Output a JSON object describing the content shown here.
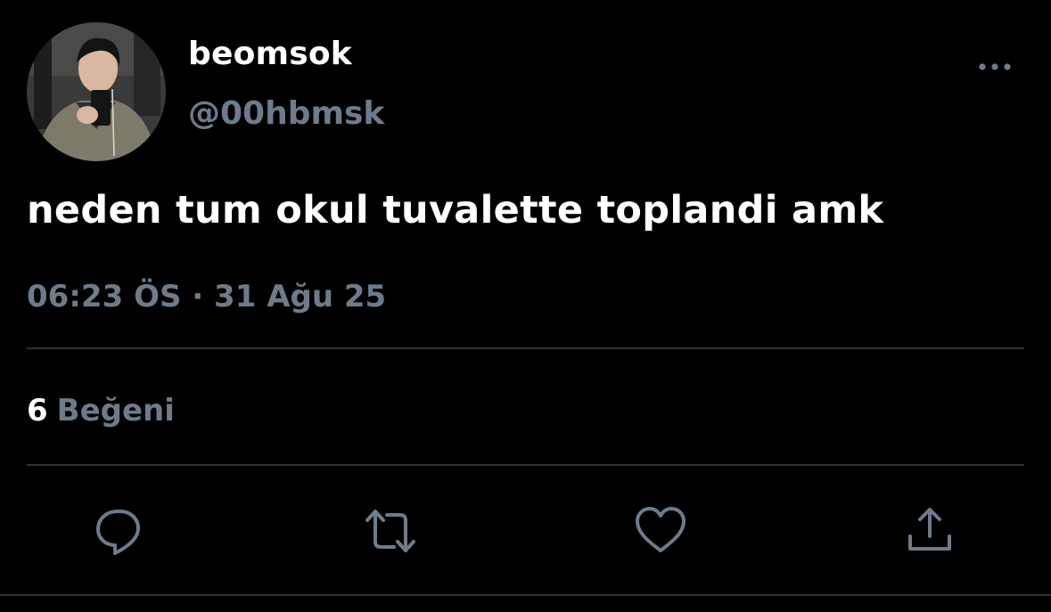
{
  "colors": {
    "background": "#000000",
    "primary_text": "#ffffff",
    "secondary_text": "#6e7b8a",
    "divider": "#2f3336",
    "icon": "#6e7b8a"
  },
  "user": {
    "display_name": "beomsok",
    "handle": "@00hbmsk",
    "avatar_icon": "profile-photo"
  },
  "tweet": {
    "text": "neden tum okul tuvalette toplandi amk",
    "timestamp": "06:23 ÖS · 31 Ağu 25"
  },
  "stats": {
    "likes_count": "6",
    "likes_label": "Beğeni"
  },
  "actions": [
    {
      "name": "reply",
      "icon": "comment-bubble-icon"
    },
    {
      "name": "retweet",
      "icon": "retweet-arrows-icon"
    },
    {
      "name": "like",
      "icon": "heart-icon"
    },
    {
      "name": "share",
      "icon": "share-upload-icon"
    }
  ],
  "header": {
    "more_icon": "more-dots-icon"
  }
}
